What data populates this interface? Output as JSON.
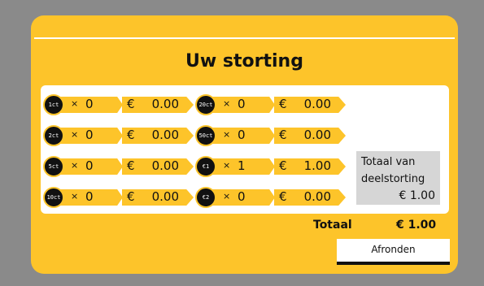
{
  "screen": {
    "title": "Uw storting",
    "colors": {
      "accent": "#fdc42a",
      "background": "#8a8a8a",
      "card": "#ffffff",
      "subtotal_box": "#d6d6d6"
    }
  },
  "coins": [
    {
      "label": "1ct",
      "quantity": "0",
      "currency": "€",
      "amount": "0.00"
    },
    {
      "label": "2ct",
      "quantity": "0",
      "currency": "€",
      "amount": "0.00"
    },
    {
      "label": "5ct",
      "quantity": "0",
      "currency": "€",
      "amount": "0.00"
    },
    {
      "label": "10ct",
      "quantity": "0",
      "currency": "€",
      "amount": "0.00"
    },
    {
      "label": "20ct",
      "quantity": "0",
      "currency": "€",
      "amount": "0.00"
    },
    {
      "label": "50ct",
      "quantity": "0",
      "currency": "€",
      "amount": "0.00"
    },
    {
      "label": "€1",
      "quantity": "1",
      "currency": "€",
      "amount": "1.00"
    },
    {
      "label": "€2",
      "quantity": "0",
      "currency": "€",
      "amount": "0.00"
    }
  ],
  "times_symbol": "×",
  "subtotal": {
    "label": "Totaal van deelstorting",
    "value": "€ 1.00"
  },
  "total": {
    "label": "Totaal",
    "value": "€ 1.00"
  },
  "actions": {
    "finish_label": "Afronden"
  }
}
